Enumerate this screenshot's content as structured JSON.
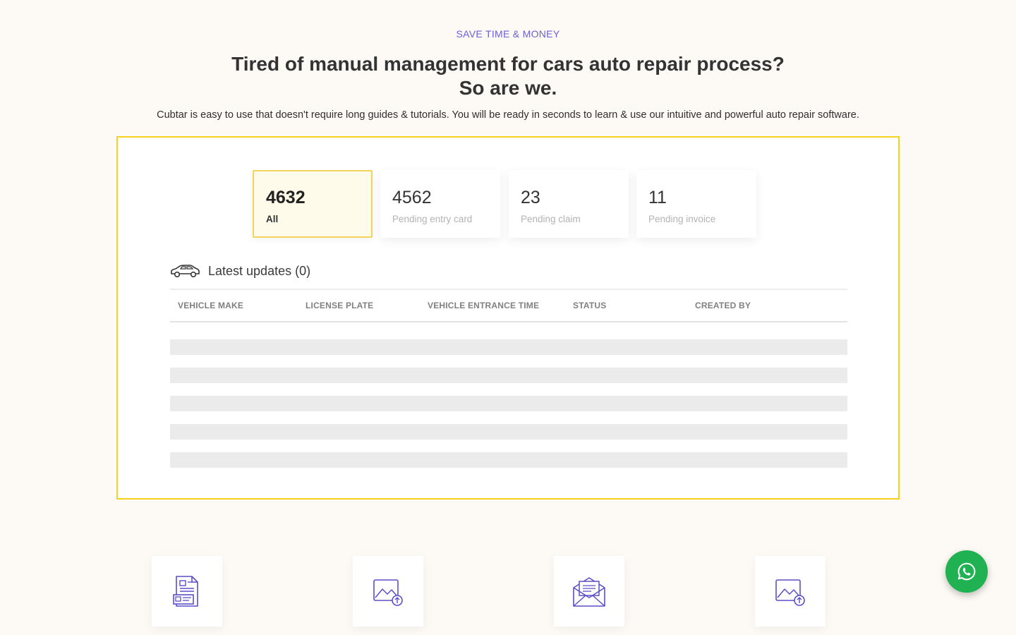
{
  "hero": {
    "eyebrow": "SAVE TIME & MONEY",
    "headline_line1": "Tired of manual management for cars auto repair process?",
    "headline_line2": "So are we.",
    "subtitle": "Cubtar is easy to use that doesn't require long guides & tutorials. You will be ready in seconds to learn & use our intuitive and powerful auto repair software."
  },
  "stats": [
    {
      "value": "4632",
      "label": "All",
      "active": true
    },
    {
      "value": "4562",
      "label": "Pending entry card",
      "active": false
    },
    {
      "value": "23",
      "label": "Pending claim",
      "active": false
    },
    {
      "value": "11",
      "label": "Pending invoice",
      "active": false
    }
  ],
  "updates": {
    "title": "Latest updates (0)",
    "icon": "car-icon",
    "columns": [
      "VEHICLE MAKE",
      "LICENSE PLATE",
      "VEHICLE ENTRANCE TIME",
      "STATUS",
      "CREATED BY"
    ],
    "placeholder_rows": 5
  },
  "features": [
    {
      "icon": "document-form-icon"
    },
    {
      "icon": "image-upload-icon"
    },
    {
      "icon": "mail-envelope-icon"
    },
    {
      "icon": "image-upload-icon"
    }
  ],
  "whatsapp": {
    "icon": "whatsapp-icon",
    "color": "#20b152"
  },
  "colors": {
    "accent": "#6b5fd3",
    "highlight_border": "#f2d21e",
    "background": "#fdfaf5"
  }
}
